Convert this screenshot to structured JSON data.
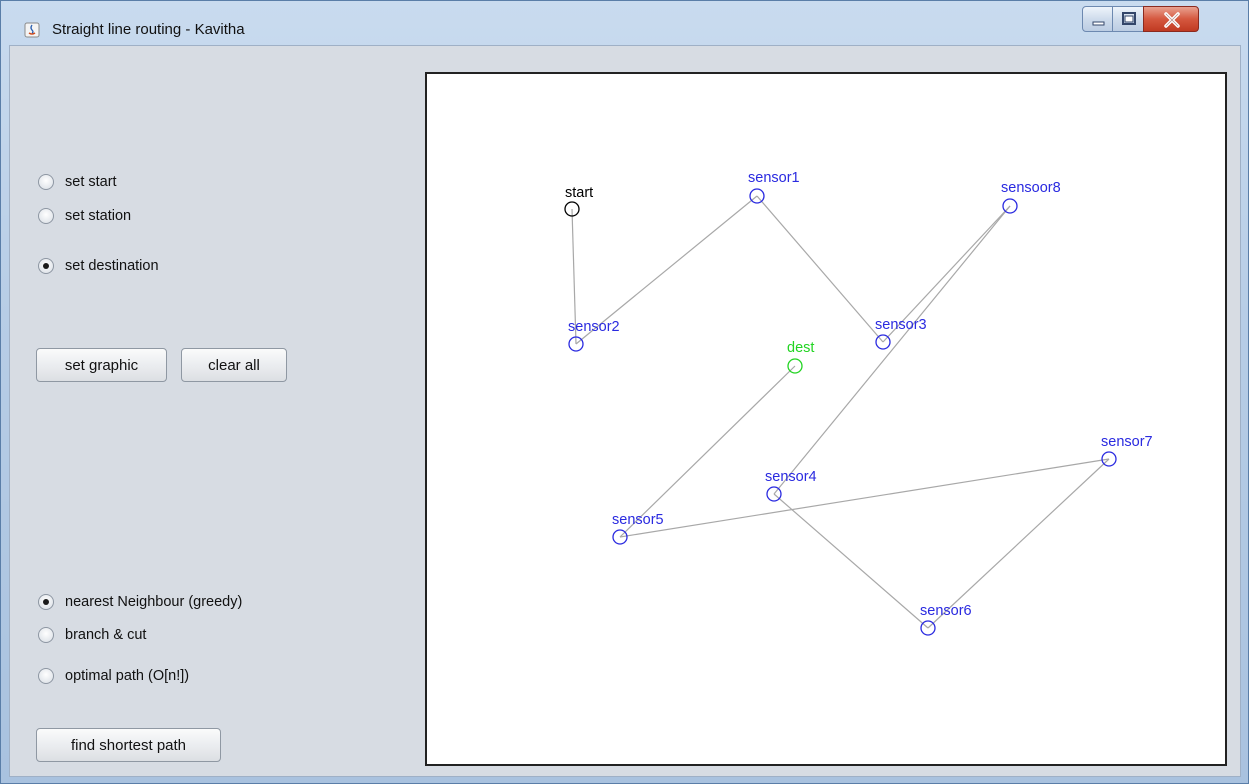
{
  "window": {
    "title": "Straight line routing - Kavitha",
    "controls": {
      "minimize": "minimize",
      "maximize": "maximize",
      "close": "close"
    }
  },
  "mode_options": [
    {
      "label": "set start",
      "checked": false
    },
    {
      "label": "set station",
      "checked": false
    },
    {
      "label": "set destination",
      "checked": true
    }
  ],
  "buttons": {
    "set_graphic": "set graphic",
    "clear_all": "clear all",
    "find_shortest_path": "find shortest path"
  },
  "algorithm_options": [
    {
      "label": "nearest Neighbour (greedy)",
      "checked": true
    },
    {
      "label": "branch & cut",
      "checked": false
    },
    {
      "label": "optimal path (O[n!])",
      "checked": false
    }
  ],
  "graph": {
    "colors": {
      "start": "#000000",
      "sensor": "#2a2ae0",
      "dest": "#22d422",
      "edge": "#a8a8a8"
    },
    "nodes": [
      {
        "id": "start",
        "label": "start",
        "type": "start"
      },
      {
        "id": "sensor1",
        "label": "sensor1",
        "type": "sensor"
      },
      {
        "id": "sensoor8",
        "label": "sensoor8",
        "type": "sensor"
      },
      {
        "id": "sensor2",
        "label": "sensor2",
        "type": "sensor"
      },
      {
        "id": "sensor3",
        "label": "sensor3",
        "type": "sensor"
      },
      {
        "id": "dest",
        "label": "dest",
        "type": "dest"
      },
      {
        "id": "sensor7",
        "label": "sensor7",
        "type": "sensor"
      },
      {
        "id": "sensor4",
        "label": "sensor4",
        "type": "sensor"
      },
      {
        "id": "sensor5",
        "label": "sensor5",
        "type": "sensor"
      },
      {
        "id": "sensor6",
        "label": "sensor6",
        "type": "sensor"
      }
    ],
    "edges": [
      [
        "start",
        "sensor2"
      ],
      [
        "sensor2",
        "sensor1"
      ],
      [
        "sensor1",
        "sensor3"
      ],
      [
        "sensor3",
        "sensoor8"
      ],
      [
        "sensoor8",
        "sensor4"
      ],
      [
        "sensor4",
        "sensor6"
      ],
      [
        "sensor6",
        "sensor7"
      ],
      [
        "sensor7",
        "sensor5"
      ],
      [
        "sensor5",
        "dest"
      ]
    ]
  }
}
